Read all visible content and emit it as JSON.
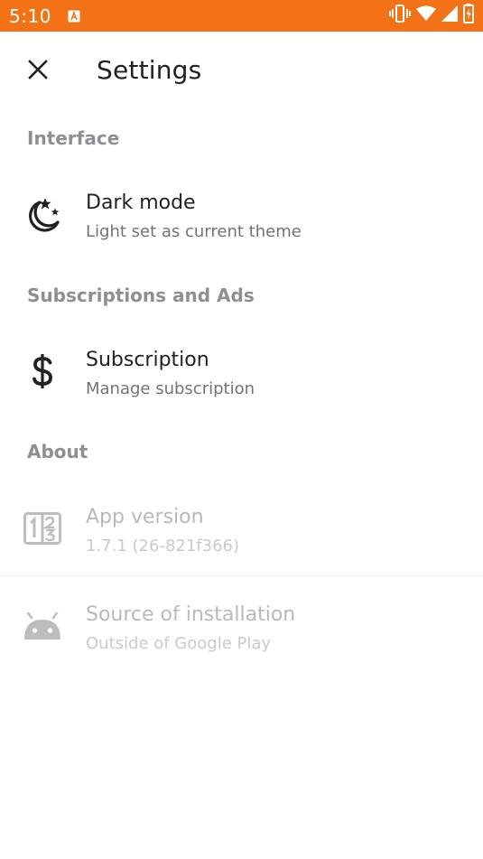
{
  "status_bar": {
    "time": "5:10",
    "notification_icon": "a-icon",
    "icons": [
      "vibrate-icon",
      "wifi-icon",
      "signal-icon",
      "battery-icon"
    ],
    "color": "#f47216"
  },
  "app_bar": {
    "title": "Settings",
    "close_icon": "close-icon"
  },
  "sections": {
    "interface": {
      "header": "Interface",
      "dark_mode": {
        "title": "Dark mode",
        "summary": "Light set as current theme",
        "icon": "moon-stars-icon"
      }
    },
    "subscriptions": {
      "header": "Subscriptions and Ads",
      "subscription": {
        "title": "Subscription",
        "summary": "Manage subscription",
        "icon": "dollar-icon"
      }
    },
    "about": {
      "header": "About",
      "app_version": {
        "title": "App version",
        "summary": "1.7.1 (26-821f366)",
        "icon": "numbers-icon"
      },
      "source": {
        "title": "Source of installation",
        "summary": "Outside of Google Play",
        "icon": "android-icon"
      }
    }
  },
  "colors": {
    "accent": "#f47216",
    "section_header": "#8c8f94",
    "disabled_title": "#b9b9b9",
    "disabled_summary": "#cacaca"
  }
}
